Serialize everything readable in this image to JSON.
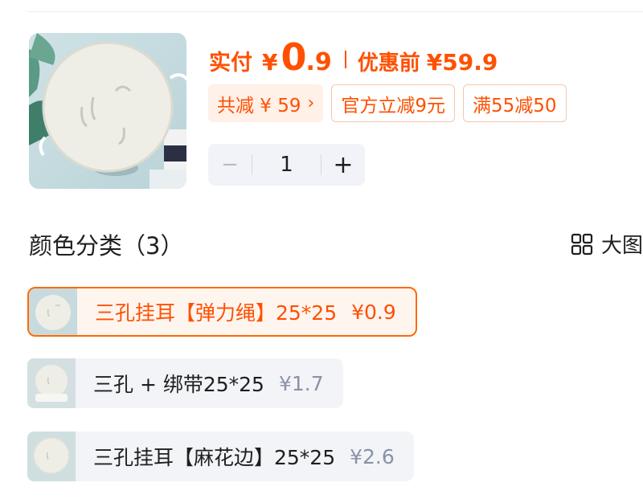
{
  "price": {
    "paid_label": "实付",
    "currency": "¥",
    "paid_int": "0",
    "paid_dec": ".9",
    "original_label": "优惠前",
    "original_price": "¥59.9"
  },
  "promo_tags": [
    {
      "text": "共减 ¥ 59",
      "chevron": "›"
    },
    {
      "text": "官方立减9元"
    },
    {
      "text": "满55减50"
    }
  ],
  "quantity": {
    "minus": "−",
    "value": "1",
    "plus": "+"
  },
  "section": {
    "title": "颜色分类（3）",
    "big_view_label": "大图"
  },
  "skus": [
    {
      "name": "三孔挂耳【弹力绳】25*25",
      "price": "¥0.9",
      "selected": true
    },
    {
      "name": "三孔 + 绑带25*25",
      "price": "¥1.7",
      "selected": false
    },
    {
      "name": "三孔挂耳【麻花边】25*25",
      "price": "¥2.6",
      "selected": false
    }
  ],
  "colors": {
    "accent": "#ff5000",
    "tag_bg": "#fff0e8",
    "chip_bg": "#f2f4f8"
  },
  "icons": {
    "big_view": "grid-icon"
  }
}
